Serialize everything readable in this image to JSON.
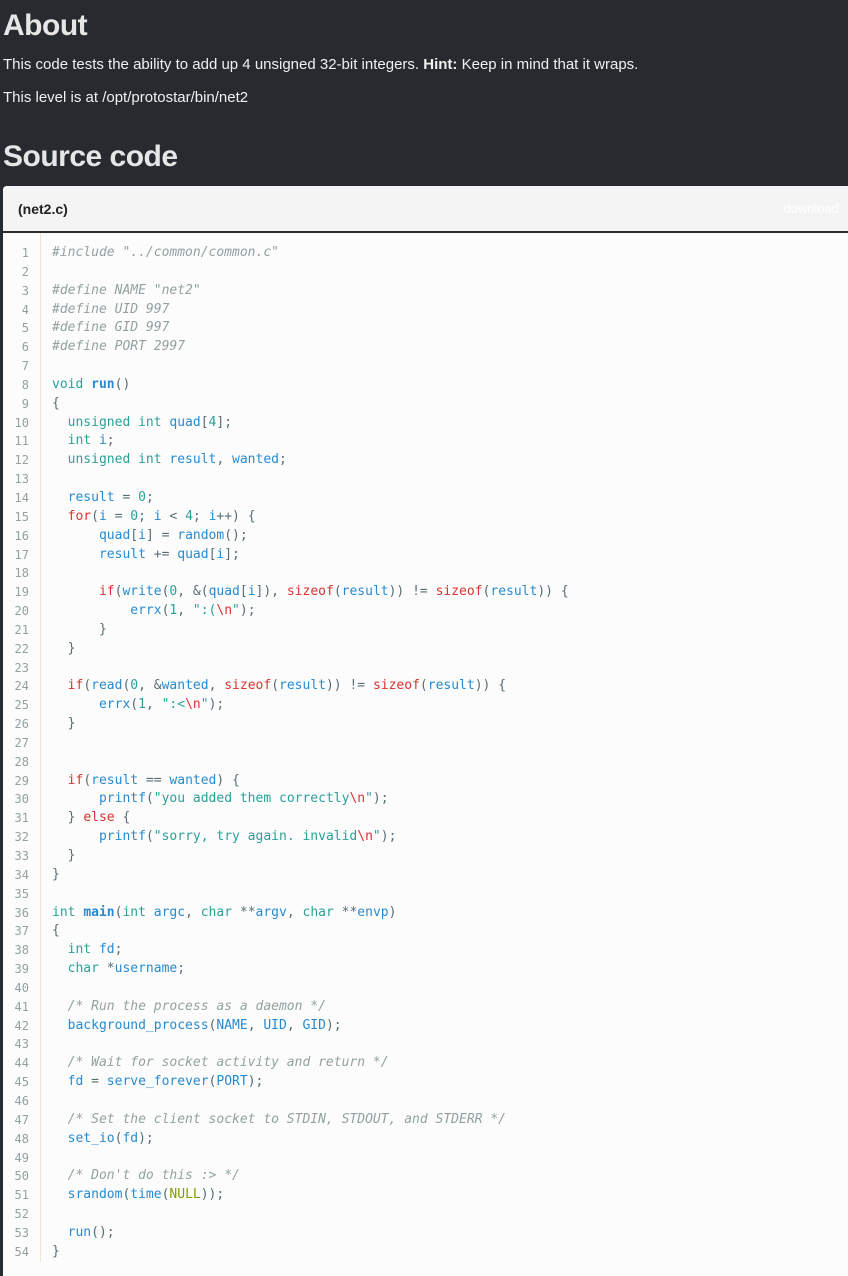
{
  "about": {
    "title": "About",
    "desc": "This code tests the ability to add up 4 unsigned 32-bit integers.",
    "hint_label": "Hint:",
    "hint": "Keep in mind that it wraps.",
    "level": "This level is at /opt/protostar/bin/net2"
  },
  "source": {
    "title": "Source code",
    "file_name": "(net2.c)",
    "download_label": "download",
    "lines": [
      [
        [
          "c",
          "#include \"../common/common.c\""
        ]
      ],
      [],
      [
        [
          "c",
          "#define NAME \"net2\""
        ]
      ],
      [
        [
          "c",
          "#define UID 997"
        ]
      ],
      [
        [
          "c",
          "#define GID 997"
        ]
      ],
      [
        [
          "c",
          "#define PORT 2997"
        ]
      ],
      [],
      [
        [
          "t",
          "void"
        ],
        [
          "p",
          " "
        ],
        [
          "fb",
          "run"
        ],
        [
          "p",
          "()"
        ]
      ],
      [
        [
          "p",
          "{"
        ]
      ],
      [
        [
          "p",
          "  "
        ],
        [
          "t",
          "unsigned int"
        ],
        [
          "p",
          " "
        ],
        [
          "f",
          "quad"
        ],
        [
          "p",
          "["
        ],
        [
          "n",
          "4"
        ],
        [
          "p",
          "];"
        ]
      ],
      [
        [
          "p",
          "  "
        ],
        [
          "t",
          "int"
        ],
        [
          "p",
          " "
        ],
        [
          "f",
          "i"
        ],
        [
          "p",
          ";"
        ]
      ],
      [
        [
          "p",
          "  "
        ],
        [
          "t",
          "unsigned int"
        ],
        [
          "p",
          " "
        ],
        [
          "f",
          "result"
        ],
        [
          "p",
          ", "
        ],
        [
          "f",
          "wanted"
        ],
        [
          "p",
          ";"
        ]
      ],
      [],
      [
        [
          "p",
          "  "
        ],
        [
          "f",
          "result"
        ],
        [
          "p",
          " = "
        ],
        [
          "n",
          "0"
        ],
        [
          "p",
          ";"
        ]
      ],
      [
        [
          "p",
          "  "
        ],
        [
          "k",
          "for"
        ],
        [
          "p",
          "("
        ],
        [
          "f",
          "i"
        ],
        [
          "p",
          " = "
        ],
        [
          "n",
          "0"
        ],
        [
          "p",
          "; "
        ],
        [
          "f",
          "i"
        ],
        [
          "p",
          " < "
        ],
        [
          "n",
          "4"
        ],
        [
          "p",
          "; "
        ],
        [
          "f",
          "i"
        ],
        [
          "p",
          "++) {"
        ]
      ],
      [
        [
          "p",
          "      "
        ],
        [
          "f",
          "quad"
        ],
        [
          "p",
          "["
        ],
        [
          "f",
          "i"
        ],
        [
          "p",
          "] = "
        ],
        [
          "f",
          "random"
        ],
        [
          "p",
          "();"
        ]
      ],
      [
        [
          "p",
          "      "
        ],
        [
          "f",
          "result"
        ],
        [
          "p",
          " += "
        ],
        [
          "f",
          "quad"
        ],
        [
          "p",
          "["
        ],
        [
          "f",
          "i"
        ],
        [
          "p",
          "];"
        ]
      ],
      [],
      [
        [
          "p",
          "      "
        ],
        [
          "k",
          "if"
        ],
        [
          "p",
          "("
        ],
        [
          "f",
          "write"
        ],
        [
          "p",
          "("
        ],
        [
          "n",
          "0"
        ],
        [
          "p",
          ", &("
        ],
        [
          "f",
          "quad"
        ],
        [
          "p",
          "["
        ],
        [
          "f",
          "i"
        ],
        [
          "p",
          "]), "
        ],
        [
          "k",
          "sizeof"
        ],
        [
          "p",
          "("
        ],
        [
          "f",
          "result"
        ],
        [
          "p",
          ")) != "
        ],
        [
          "k",
          "sizeof"
        ],
        [
          "p",
          "("
        ],
        [
          "f",
          "result"
        ],
        [
          "p",
          ")) {"
        ]
      ],
      [
        [
          "p",
          "          "
        ],
        [
          "f",
          "errx"
        ],
        [
          "p",
          "("
        ],
        [
          "n",
          "1"
        ],
        [
          "p",
          ", "
        ],
        [
          "s",
          "\":("
        ],
        [
          "e",
          "\\n"
        ],
        [
          "s",
          "\""
        ],
        [
          "p",
          ");"
        ]
      ],
      [
        [
          "p",
          "      }"
        ]
      ],
      [
        [
          "p",
          "  }"
        ]
      ],
      [],
      [
        [
          "p",
          "  "
        ],
        [
          "k",
          "if"
        ],
        [
          "p",
          "("
        ],
        [
          "f",
          "read"
        ],
        [
          "p",
          "("
        ],
        [
          "n",
          "0"
        ],
        [
          "p",
          ", &"
        ],
        [
          "f",
          "wanted"
        ],
        [
          "p",
          ", "
        ],
        [
          "k",
          "sizeof"
        ],
        [
          "p",
          "("
        ],
        [
          "f",
          "result"
        ],
        [
          "p",
          ")) != "
        ],
        [
          "k",
          "sizeof"
        ],
        [
          "p",
          "("
        ],
        [
          "f",
          "result"
        ],
        [
          "p",
          ")) {"
        ]
      ],
      [
        [
          "p",
          "      "
        ],
        [
          "f",
          "errx"
        ],
        [
          "p",
          "("
        ],
        [
          "n",
          "1"
        ],
        [
          "p",
          ", "
        ],
        [
          "s",
          "\":<"
        ],
        [
          "e",
          "\\n"
        ],
        [
          "s",
          "\""
        ],
        [
          "p",
          ");"
        ]
      ],
      [
        [
          "p",
          "  }"
        ]
      ],
      [],
      [],
      [
        [
          "p",
          "  "
        ],
        [
          "k",
          "if"
        ],
        [
          "p",
          "("
        ],
        [
          "f",
          "result"
        ],
        [
          "p",
          " == "
        ],
        [
          "f",
          "wanted"
        ],
        [
          "p",
          ") {"
        ]
      ],
      [
        [
          "p",
          "      "
        ],
        [
          "f",
          "printf"
        ],
        [
          "p",
          "("
        ],
        [
          "s",
          "\"you added them correctly"
        ],
        [
          "e",
          "\\n"
        ],
        [
          "s",
          "\""
        ],
        [
          "p",
          ");"
        ]
      ],
      [
        [
          "p",
          "  } "
        ],
        [
          "k",
          "else"
        ],
        [
          "p",
          " {"
        ]
      ],
      [
        [
          "p",
          "      "
        ],
        [
          "f",
          "printf"
        ],
        [
          "p",
          "("
        ],
        [
          "s",
          "\"sorry, try again. invalid"
        ],
        [
          "e",
          "\\n"
        ],
        [
          "s",
          "\""
        ],
        [
          "p",
          ");"
        ]
      ],
      [
        [
          "p",
          "  }"
        ]
      ],
      [
        [
          "p",
          "}"
        ]
      ],
      [],
      [
        [
          "t",
          "int"
        ],
        [
          "p",
          " "
        ],
        [
          "fb",
          "main"
        ],
        [
          "p",
          "("
        ],
        [
          "t",
          "int"
        ],
        [
          "p",
          " "
        ],
        [
          "f",
          "argc"
        ],
        [
          "p",
          ", "
        ],
        [
          "t",
          "char"
        ],
        [
          "p",
          " **"
        ],
        [
          "f",
          "argv"
        ],
        [
          "p",
          ", "
        ],
        [
          "t",
          "char"
        ],
        [
          "p",
          " **"
        ],
        [
          "f",
          "envp"
        ],
        [
          "p",
          ")"
        ]
      ],
      [
        [
          "p",
          "{"
        ]
      ],
      [
        [
          "p",
          "  "
        ],
        [
          "t",
          "int"
        ],
        [
          "p",
          " "
        ],
        [
          "f",
          "fd"
        ],
        [
          "p",
          ";"
        ]
      ],
      [
        [
          "p",
          "  "
        ],
        [
          "t",
          "char"
        ],
        [
          "p",
          " *"
        ],
        [
          "f",
          "username"
        ],
        [
          "p",
          ";"
        ]
      ],
      [],
      [
        [
          "p",
          "  "
        ],
        [
          "c",
          "/* Run the process as a daemon */"
        ]
      ],
      [
        [
          "p",
          "  "
        ],
        [
          "f",
          "background_process"
        ],
        [
          "p",
          "("
        ],
        [
          "f",
          "NAME"
        ],
        [
          "p",
          ", "
        ],
        [
          "f",
          "UID"
        ],
        [
          "p",
          ", "
        ],
        [
          "f",
          "GID"
        ],
        [
          "p",
          ");"
        ]
      ],
      [],
      [
        [
          "p",
          "  "
        ],
        [
          "c",
          "/* Wait for socket activity and return */"
        ]
      ],
      [
        [
          "p",
          "  "
        ],
        [
          "f",
          "fd"
        ],
        [
          "p",
          " = "
        ],
        [
          "f",
          "serve_forever"
        ],
        [
          "p",
          "("
        ],
        [
          "f",
          "PORT"
        ],
        [
          "p",
          ");"
        ]
      ],
      [],
      [
        [
          "p",
          "  "
        ],
        [
          "c",
          "/* Set the client socket to STDIN, STDOUT, and STDERR */"
        ]
      ],
      [
        [
          "p",
          "  "
        ],
        [
          "f",
          "set_io"
        ],
        [
          "p",
          "("
        ],
        [
          "f",
          "fd"
        ],
        [
          "p",
          ");"
        ]
      ],
      [],
      [
        [
          "p",
          "  "
        ],
        [
          "c",
          "/* Don't do this :> */"
        ]
      ],
      [
        [
          "p",
          "  "
        ],
        [
          "f",
          "srandom"
        ],
        [
          "p",
          "("
        ],
        [
          "f",
          "time"
        ],
        [
          "p",
          "("
        ],
        [
          "nl",
          "NULL"
        ],
        [
          "p",
          "));"
        ]
      ],
      [],
      [
        [
          "p",
          "  "
        ],
        [
          "f",
          "run"
        ],
        [
          "p",
          "();"
        ]
      ],
      [
        [
          "p",
          "}"
        ]
      ]
    ]
  }
}
